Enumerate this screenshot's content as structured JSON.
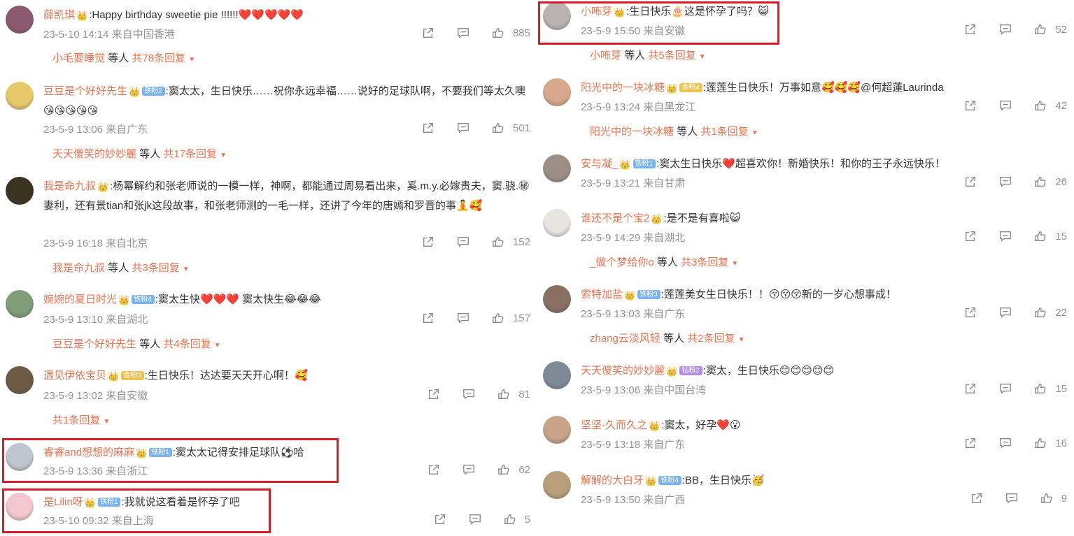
{
  "accent": "#eb7350",
  "highlight_color": "#d61c2b",
  "labels": {
    "others": "等人"
  },
  "left": [
    {
      "user": "薛凯琪",
      "badge": null,
      "text": ":Happy birthday sweetie pie !!!!!!",
      "emoji": "❤️❤️❤️❤️❤️",
      "time": "23-5-10 14:14 来自中国香港",
      "likes": "885",
      "reply_user": "小毛要睡觉",
      "reply_count": "共78条回复",
      "avatar_color": "#8b5a70"
    },
    {
      "user": "豆豆是个好好先生",
      "badge": {
        "label": "铁粉2",
        "tone": "blue"
      },
      "text": ":窦太太，生日快乐……祝你永远幸福……说好的足球队啊，不要我们等太久噢",
      "emoji": "😘😘😘😘😘",
      "time": "23-5-9 13:06 来自广东",
      "likes": "501",
      "reply_user": "天天傻笑的妙妙麗",
      "reply_count": "共17条回复",
      "avatar_color": "#e7c86a"
    },
    {
      "user": "我是命九叔",
      "badge": null,
      "text": ":杨幂解约和张老师说的一模一样，神啊，都能通过周易看出来，奚.m.y.必嫁贵夫，窦.骁.㊙妻利，还有景tian和张jk这段故事，和张老师测的一毛一样，还讲了今年的唐嫣和罗晋的事",
      "emoji": "🧘🥰",
      "time": "23-5-9 16:18 来自北京",
      "likes": "152",
      "reply_user": "我是命九叔",
      "reply_count": "共3条回复",
      "avatar_color": "#3a3320"
    },
    {
      "user": "婉婉的夏日时光",
      "badge": {
        "label": "铁粉4",
        "tone": "blue"
      },
      "text": ":窦太生快",
      "emoji": "❤️❤️❤️  窦太快生😂😂😂",
      "time": "23-5-9 13:10 来自湖北",
      "likes": "157",
      "reply_user": "豆豆是个好好先生",
      "reply_count": "共4条回复",
      "avatar_color": "#7e9d78"
    },
    {
      "user": "遇见伊依宝贝",
      "badge": {
        "label": "金粉3",
        "tone": "gold"
      },
      "text": ":生日快乐！达达要天天开心啊！",
      "emoji": "🥰",
      "time": "23-5-9 13:02 来自安徽",
      "likes": "81",
      "reply_user": "",
      "reply_count": "共1条回复",
      "avatar_color": "#6e5a44"
    },
    {
      "user": "睿睿and想想的麻麻",
      "badge": {
        "label": "铁粉1",
        "tone": "blue"
      },
      "text": ":窦太太记得安排足球队⚽哈",
      "emoji": "",
      "time": "23-5-9 13:36 来自浙江",
      "likes": "62",
      "reply_user": "",
      "reply_count": "",
      "avatar_color": "#bfc6cf"
    },
    {
      "user": "是Lilin呀",
      "badge": {
        "label": "铁粉1",
        "tone": "blue"
      },
      "text": ":我就说这看着是怀孕了吧",
      "emoji": "",
      "time": "23-5-10 09:32 来自上海",
      "likes": "5",
      "reply_user": "",
      "reply_count": "",
      "avatar_color": "#f3c7cf"
    }
  ],
  "right": [
    {
      "user": "小咘芽",
      "badge": null,
      "text": ":生日快乐🎂这是怀孕了吗？",
      "emoji": "😺",
      "time": "23-5-9 15:50 来自安徽",
      "likes": "52",
      "reply_user": "小咘芽",
      "reply_count": "共5条回复",
      "avatar_color": "#b9b2b0"
    },
    {
      "user": "阳光中的一块冰糖",
      "badge": {
        "label": "金粉4",
        "tone": "gold"
      },
      "text": ":莲莲生日快乐！万事如意",
      "emoji": "🥰🥰🥰@何超蓮Laurinda",
      "time": "23-5-9 13:24 来自黑龙江",
      "likes": "42",
      "reply_user": "阳光中的一块冰糖",
      "reply_count": "共1条回复",
      "avatar_color": "#d8a88c"
    },
    {
      "user": "安与凝_",
      "badge": {
        "label": "铁粉1",
        "tone": "blue"
      },
      "text": ":窦太生日快乐❤️超喜欢你！新婚快乐！和你的王子永远快乐！",
      "emoji": "",
      "time": "23-5-9 13:21 来自甘肃",
      "likes": "26",
      "reply_user": "",
      "reply_count": "",
      "avatar_color": "#9c8f86"
    },
    {
      "user": "谁还不是个宝2",
      "badge": null,
      "text": ":是不是有喜啦",
      "emoji": "😺",
      "time": "23-5-9 14:29 来自湖北",
      "likes": "15",
      "reply_user": "_做个梦给你o",
      "reply_count": "共3条回复",
      "avatar_color": "#e8e4e0"
    },
    {
      "user": "索特加盐",
      "badge": {
        "label": "铁粉3",
        "tone": "blue"
      },
      "text": ":莲莲美女生日快乐！！",
      "emoji": "😚😚😚新的一岁心想事成！",
      "time": "23-5-9 13:03 来自广东",
      "likes": "22",
      "reply_user": "zhang云淡风轻",
      "reply_count": "共2条回复",
      "avatar_color": "#8a6f63"
    },
    {
      "user": "天天傻笑的妙妙麗",
      "badge": {
        "label": "钻粉2",
        "tone": "purple"
      },
      "text": ":窦太，生日快乐",
      "emoji": "😊😊😊😊😊",
      "time": "23-5-9 13:06 来自中国台湾",
      "likes": "15",
      "reply_user": "",
      "reply_count": "",
      "avatar_color": "#7f8a97"
    },
    {
      "user": "坚坚-久而久之",
      "badge": null,
      "text": ":窦太，好孕❤️",
      "emoji": "😮",
      "time": "23-5-9 13:18 来自广东",
      "likes": "16",
      "reply_user": "",
      "reply_count": "",
      "avatar_color": "#c9a489"
    },
    {
      "user": "解解的大白牙",
      "badge": {
        "label": "铁粉4",
        "tone": "blue"
      },
      "text": ":BB，生日快乐",
      "emoji": "🥳",
      "time": "23-5-9 13:50 来自广西",
      "likes": "9",
      "reply_user": "",
      "reply_count": "",
      "avatar_color": "#b99e7a"
    }
  ]
}
